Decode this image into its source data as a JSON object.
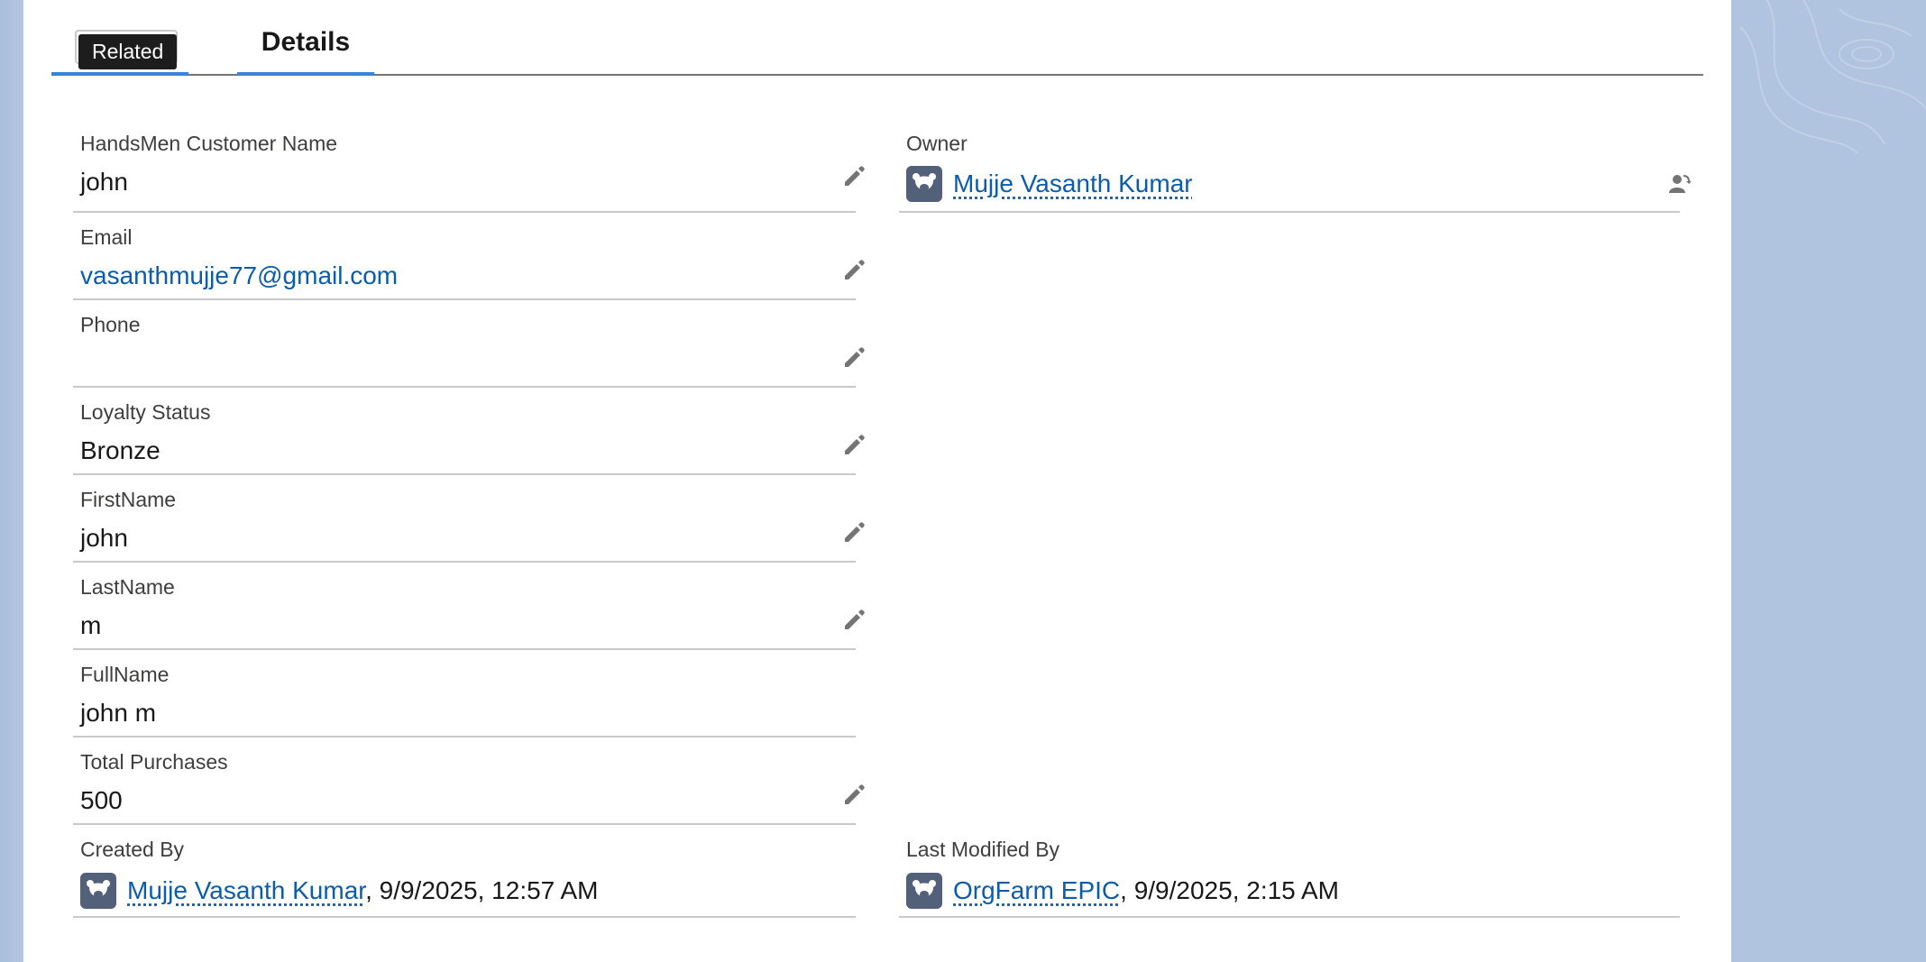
{
  "tabs": {
    "related": "Related",
    "details": "Details",
    "tooltip": "Related"
  },
  "fields": {
    "customer_name": {
      "label": "HandsMen Customer Name",
      "value": "john"
    },
    "email": {
      "label": "Email",
      "value": "vasanthmujje77@gmail.com"
    },
    "phone": {
      "label": "Phone",
      "value": ""
    },
    "loyalty_status": {
      "label": "Loyalty Status",
      "value": "Bronze"
    },
    "first_name": {
      "label": "FirstName",
      "value": "john"
    },
    "last_name": {
      "label": "LastName",
      "value": "m"
    },
    "full_name": {
      "label": "FullName",
      "value": "john m"
    },
    "total_purchases": {
      "label": "Total Purchases",
      "value": "500"
    },
    "owner": {
      "label": "Owner",
      "value": "Mujje Vasanth Kumar"
    },
    "created_by": {
      "label": "Created By",
      "user": "Mujje Vasanth Kumar",
      "timestamp": ", 9/9/2025, 12:57 AM"
    },
    "last_modified_by": {
      "label": "Last Modified By",
      "user": "OrgFarm EPIC",
      "timestamp": ", 9/9/2025, 2:15 AM"
    }
  },
  "icons": {
    "edit": "pencil-icon",
    "avatar": "user-avatar-icon",
    "change_owner": "change-owner-icon"
  },
  "colors": {
    "link": "#0b5cab",
    "tab_accent": "#3b82db",
    "avatar_bg": "#53607a",
    "background": "#b0c4df"
  }
}
